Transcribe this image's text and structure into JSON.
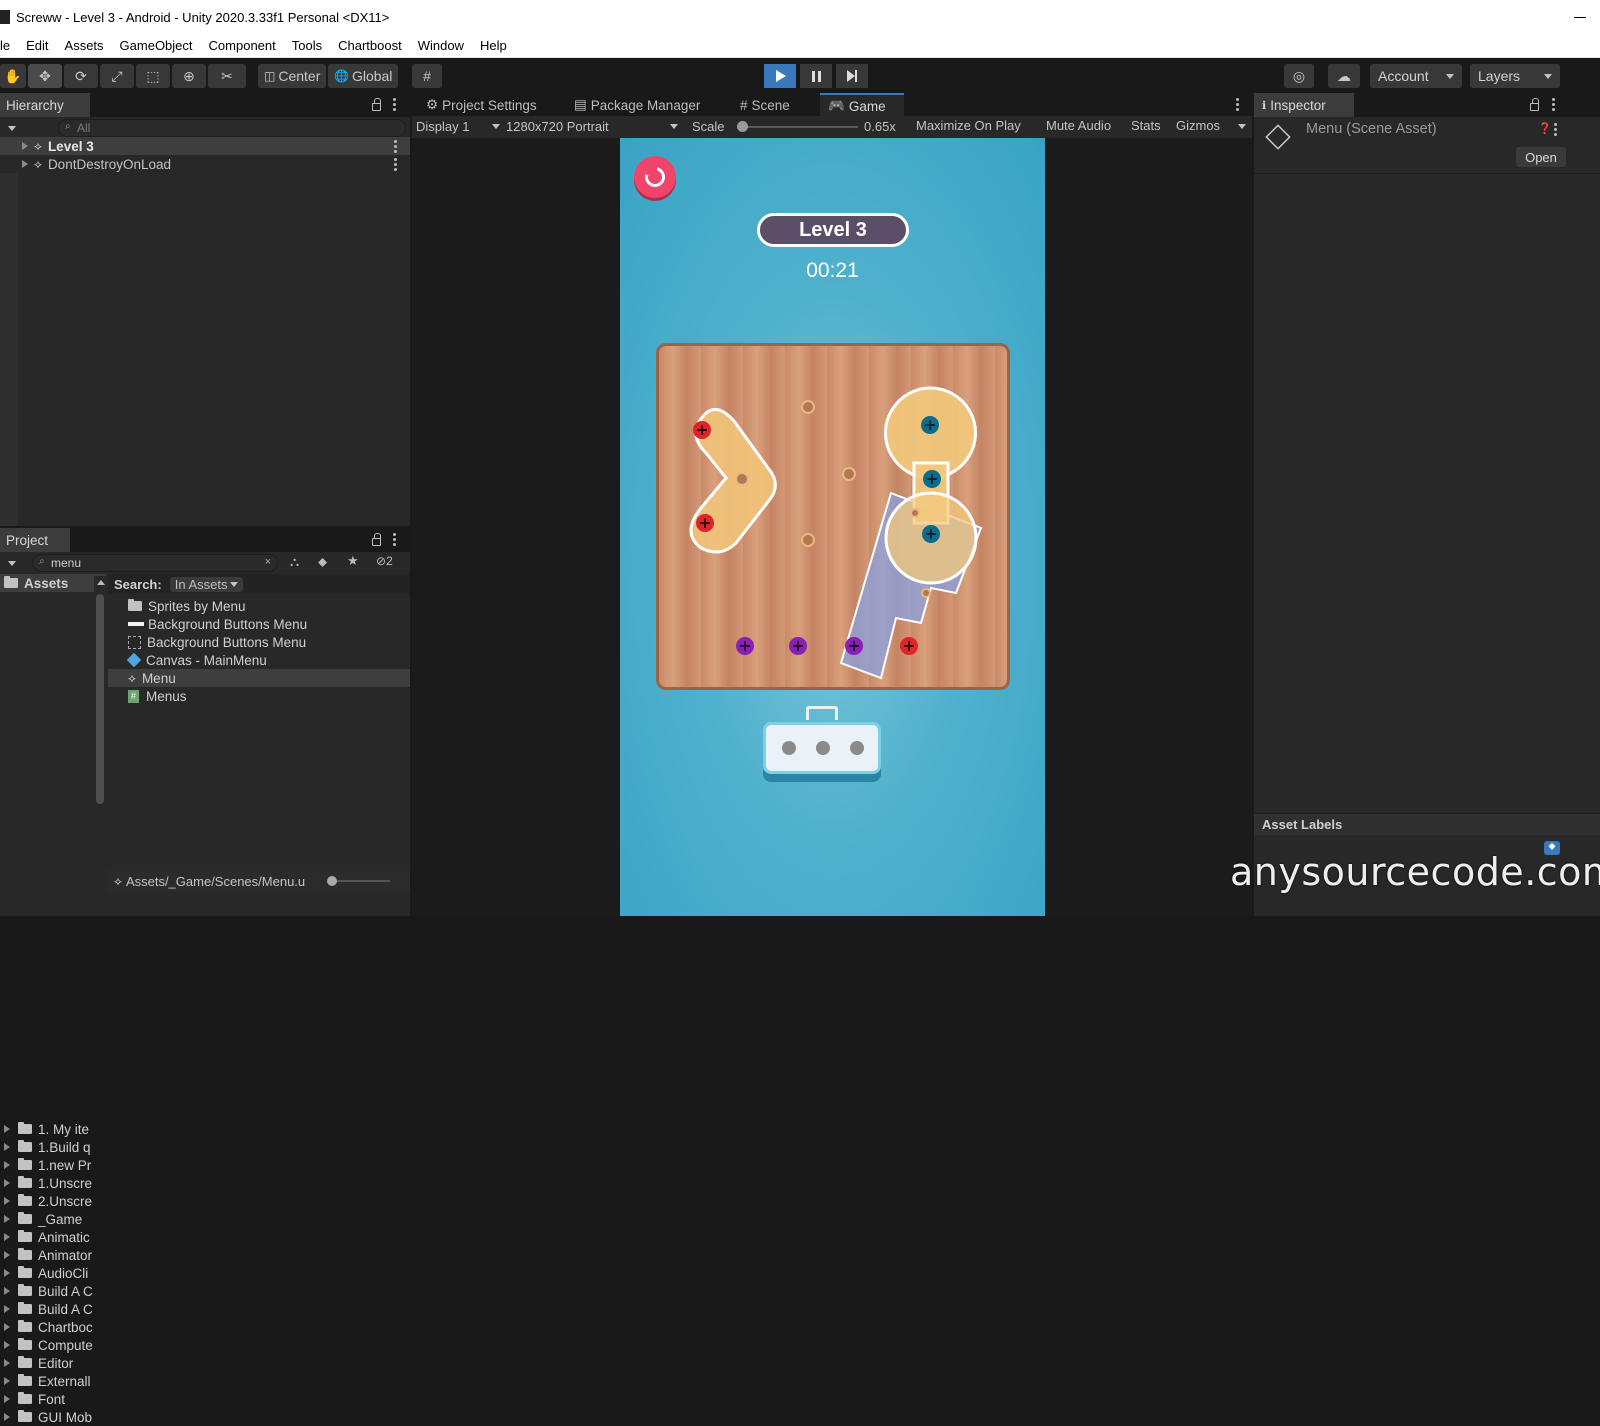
{
  "window": {
    "title": "Screww - Level 3 - Android - Unity 2020.3.33f1 Personal <DX11>"
  },
  "menubar": {
    "items": [
      "le",
      "Edit",
      "Assets",
      "GameObject",
      "Component",
      "Tools",
      "Chartboost",
      "Window",
      "Help"
    ]
  },
  "toolbar": {
    "pivot_label": "Center",
    "space_label": "Global",
    "account_label": "Account",
    "layers_label": "Layers"
  },
  "hierarchy": {
    "tab_label": "Hierarchy",
    "search_placeholder": "All",
    "rows": [
      "Level 3",
      "DontDestroyOnLoad"
    ]
  },
  "center_tabs": [
    "Project Settings",
    "Package Manager",
    "Scene",
    "Game"
  ],
  "game_controls": {
    "display": "Display 1",
    "resolution": "1280x720 Portrait",
    "scale_label": "Scale",
    "scale_value": "0.65x",
    "scale_fraction": 0.0,
    "maximize": "Maximize On Play",
    "mute": "Mute Audio",
    "stats": "Stats",
    "gizmos": "Gizmos"
  },
  "game": {
    "level_label": "Level 3",
    "timer": "00:21"
  },
  "inspector": {
    "tab_label": "Inspector",
    "asset_title": "Menu (Scene Asset)",
    "open_button": "Open",
    "asset_labels": "Asset Labels"
  },
  "project": {
    "tab_label": "Project",
    "search_value": "menu",
    "hidden_count": "2",
    "root_label": "Assets",
    "tree": [
      "1. My ite",
      "1.Build q",
      "1.new Pr",
      "1.Unscre",
      "2.Unscre",
      "_Game",
      "Animatic",
      "Animator",
      "AudioCli",
      "Build A C",
      "Build A C",
      "Chartboc",
      "Compute",
      "Editor",
      "Externall",
      "Font",
      "GUI Mob"
    ],
    "search_label": "Search:",
    "search_scope": "In Assets",
    "results": [
      "Sprites by Menu",
      "Background Buttons Menu",
      "Background Buttons Menu",
      "Canvas - MainMenu",
      "Menu",
      "Menus"
    ],
    "path": "Assets/_Game/Scenes/Menu.u"
  },
  "watermark": "anysourcecode.com",
  "colors": {
    "accent": "#3a79bb",
    "panel": "#282828",
    "game_bg": "#48abc9",
    "screw_red": "#e0242c",
    "screw_blue": "#0a6d8c",
    "screw_purple": "#8a1fb5"
  }
}
